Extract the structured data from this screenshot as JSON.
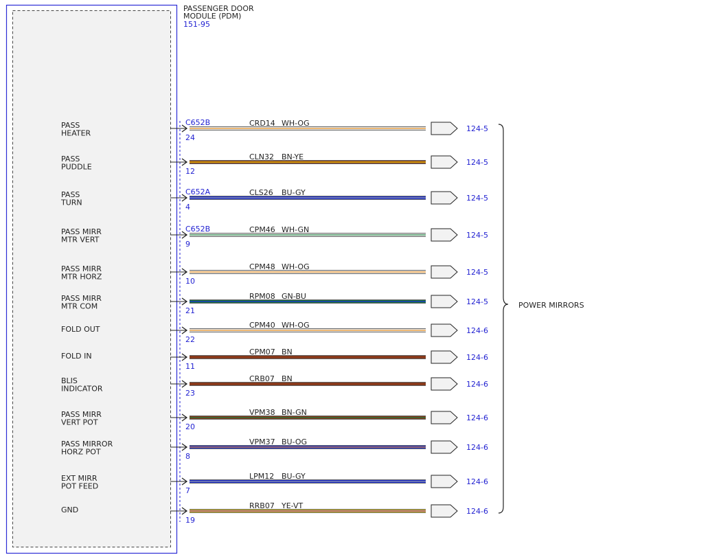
{
  "module": {
    "title_lines": [
      "PASSENGER DOOR",
      "MODULE (PDM)"
    ],
    "code": "151-95"
  },
  "group_label": "POWER MIRRORS",
  "colors": {
    "module_border": "#2b2bd6",
    "module_fill": "#f2f2f2",
    "link_text": "#1f1fd1",
    "wire_codes": {
      "WH": "#ffffff",
      "OG": "#e08a1e",
      "BN": "#8b3a1a",
      "YE": "#f2d20c",
      "BU": "#1a2ee0",
      "GY": "#9a9a9a",
      "GN": "#1a7a3a",
      "VT": "#7a2ad0"
    }
  },
  "circuits": [
    {
      "label": [
        "PASS",
        "HEATER"
      ],
      "connector": "C652B",
      "pin": "24",
      "circuit": "CRD14",
      "color_code": "WH-OG",
      "dest": "124-5"
    },
    {
      "label": [
        "PASS",
        "PUDDLE"
      ],
      "connector": "",
      "pin": "12",
      "circuit": "CLN32",
      "color_code": "BN-YE",
      "dest": "124-5"
    },
    {
      "label": [
        "PASS",
        "TURN"
      ],
      "connector": "C652A",
      "pin": "4",
      "circuit": "CLS26",
      "color_code": "BU-GY",
      "dest": "124-5"
    },
    {
      "label": [
        "PASS MIRR",
        "MTR VERT"
      ],
      "connector": "C652B",
      "pin": "9",
      "circuit": "CPM46",
      "color_code": "WH-GN",
      "dest": "124-5"
    },
    {
      "label": [
        "PASS MIRR",
        "MTR HORZ"
      ],
      "connector": "",
      "pin": "10",
      "circuit": "CPM48",
      "color_code": "WH-OG",
      "dest": "124-5"
    },
    {
      "label": [
        "PASS MIRR",
        "MTR COM"
      ],
      "connector": "",
      "pin": "21",
      "circuit": "RPM08",
      "color_code": "GN-BU",
      "dest": "124-5"
    },
    {
      "label": [
        "FOLD OUT"
      ],
      "connector": "",
      "pin": "22",
      "circuit": "CPM40",
      "color_code": "WH-OG",
      "dest": "124-6"
    },
    {
      "label": [
        "FOLD IN"
      ],
      "connector": "",
      "pin": "11",
      "circuit": "CPM07",
      "color_code": "BN",
      "dest": "124-6"
    },
    {
      "label": [
        "BLIS",
        "INDICATOR"
      ],
      "connector": "",
      "pin": "23",
      "circuit": "CRB07",
      "color_code": "BN",
      "dest": "124-6"
    },
    {
      "label": [
        "PASS MIRR",
        "VERT POT"
      ],
      "connector": "",
      "pin": "20",
      "circuit": "VPM38",
      "color_code": "BN-GN",
      "dest": "124-6"
    },
    {
      "label": [
        "PASS MIRROR",
        "HORZ POT"
      ],
      "connector": "",
      "pin": "8",
      "circuit": "VPM37",
      "color_code": "BU-OG",
      "dest": "124-6"
    },
    {
      "label": [
        "EXT MIRR",
        "POT FEED"
      ],
      "connector": "",
      "pin": "7",
      "circuit": "LPM12",
      "color_code": "BU-GY",
      "dest": "124-6"
    },
    {
      "label": [
        "GND"
      ],
      "connector": "",
      "pin": "19",
      "circuit": "RRB07",
      "color_code": "YE-VT",
      "dest": "124-6"
    }
  ]
}
